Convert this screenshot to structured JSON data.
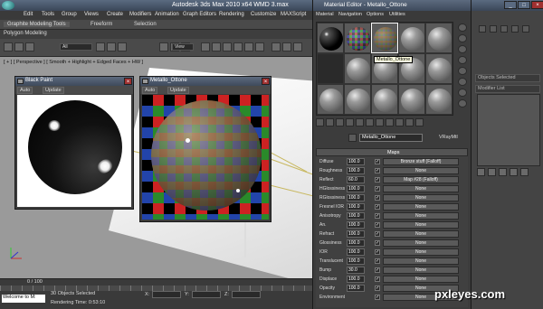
{
  "app": {
    "title": "Autodesk 3ds Max  2010 x64      WMD 3.max",
    "menu": [
      "Edit",
      "Tools",
      "Group",
      "Views",
      "Create",
      "Modifiers",
      "Animation",
      "Graph Editors",
      "Rendering",
      "Customize",
      "MAXScript"
    ],
    "ribbon_tabs": [
      "Graphite Modeling Tools",
      "Freeform",
      "Selection"
    ],
    "sub_ribbon": "Polygon Modeling",
    "toolbar_select_all": "All",
    "toolbar_view": "View"
  },
  "viewport": {
    "label": "[ + ] [ Perspective ] [ Smooth + Highlight + Edged Faces + HW ]"
  },
  "preview_black": {
    "title": "Black Paint",
    "auto": "Auto",
    "update": "Update"
  },
  "preview_metallo": {
    "title": "Metallo_Ottone",
    "auto": "Auto",
    "update": "Update"
  },
  "material_editor": {
    "title": "Material Editor - Metallo_Ottone",
    "menu": [
      "Material",
      "Navigation",
      "Options",
      "Utilities"
    ],
    "tooltip": "Metallo_Ottone",
    "material_name": "Metallo_Ottone",
    "material_type": "VRayMtl",
    "maps_header": "Maps",
    "maps": [
      {
        "label": "Diffuse",
        "amount": "100.0",
        "checked": true,
        "map": "Bronze stuff (Falloff)"
      },
      {
        "label": "Roughness",
        "amount": "100.0",
        "checked": true,
        "map": "None"
      },
      {
        "label": "Reflect",
        "amount": "60.0",
        "checked": true,
        "map": "Map #28 (Falloff)"
      },
      {
        "label": "HGlossiness",
        "amount": "100.0",
        "checked": true,
        "map": "None"
      },
      {
        "label": "RGlossiness",
        "amount": "100.0",
        "checked": true,
        "map": "None"
      },
      {
        "label": "Fresnel IOR",
        "amount": "100.0",
        "checked": true,
        "map": "None"
      },
      {
        "label": "Anisotropy",
        "amount": "100.0",
        "checked": true,
        "map": "None"
      },
      {
        "label": "An.",
        "amount": "100.0",
        "checked": true,
        "map": "None"
      },
      {
        "label": "Refract",
        "amount": "100.0",
        "checked": true,
        "map": "None"
      },
      {
        "label": "Glossiness",
        "amount": "100.0",
        "checked": true,
        "map": "None"
      },
      {
        "label": "IOR",
        "amount": "100.0",
        "checked": true,
        "map": "None"
      },
      {
        "label": "Translucent",
        "amount": "100.0",
        "checked": true,
        "map": "None"
      },
      {
        "label": "Bump",
        "amount": "30.0",
        "checked": true,
        "map": "None"
      },
      {
        "label": "Displace",
        "amount": "100.0",
        "checked": true,
        "map": "None"
      },
      {
        "label": "Opacity",
        "amount": "100.0",
        "checked": true,
        "map": "None"
      },
      {
        "label": "Environment",
        "amount": "",
        "checked": true,
        "map": "None"
      }
    ]
  },
  "command_panel": {
    "objects_selected": "Objects Selected",
    "modifier_list": "Modifier List"
  },
  "timeline": {
    "frame": "0 / 100"
  },
  "status": {
    "maxscript": "Welcome to M:",
    "selected": "30 Objects Selected",
    "render_time": "Rendering Time: 0:53:10",
    "x_label": "X:",
    "y_label": "Y:",
    "z_label": "Z:"
  },
  "watermark": "pxleyes.com"
}
